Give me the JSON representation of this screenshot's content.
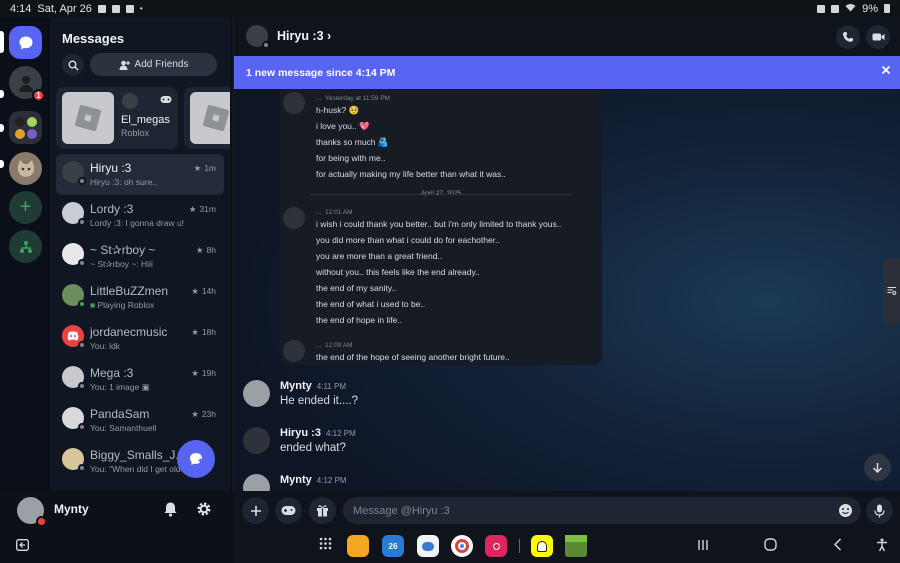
{
  "statusbar": {
    "time": "4:14",
    "date": "Sat, Apr 26",
    "battery": "9%"
  },
  "dm_panel": {
    "title": "Messages",
    "add_friends_label": "Add Friends",
    "rail_badge": "1",
    "activity": {
      "name": "El_megas",
      "game": "Roblox"
    },
    "dms": [
      {
        "name": "Hiryu :3",
        "sub": "Hiryu :3: oh sure..",
        "time": "1m",
        "active": true,
        "color": "#3b3f46"
      },
      {
        "name": "Lordy :3",
        "sub": "Lordy :3: I gonna draw u!",
        "time": "31m",
        "color": "#c9ccd1"
      },
      {
        "name": "~ St✰rboy ~",
        "sub": "~ St✰rboy ~: Hiii",
        "time": "8h",
        "color": "#e8e8e8"
      },
      {
        "name": "LittleBuZZmen",
        "sub": "Playing Roblox",
        "time": "14h",
        "color": "#6b8f5a"
      },
      {
        "name": "jordanecmusic",
        "sub": "You: ldk",
        "time": "18h",
        "color": "#ed4245"
      },
      {
        "name": "Mega :3",
        "sub": "You: 1 image",
        "time": "19h",
        "color": "#c7c9cc"
      },
      {
        "name": "PandaSam",
        "sub": "You: Samanthuell",
        "time": "23h",
        "color": "#d9d9d9"
      },
      {
        "name": "Biggy_Smalls_J...",
        "sub": "You: \"When did I get olde",
        "time": "",
        "color": "#d8c79a"
      }
    ]
  },
  "profile": {
    "name": "Mynty"
  },
  "chat": {
    "header_name": "Hiryu :3",
    "banner_text": "1 new message since 4:14 PM",
    "quoted": {
      "block1_meta": "Yesterday at 11:59 PM",
      "block1_lines": [
        "h-husk? 🥺",
        "i love you.. 💖",
        "thanks so much 🫂",
        "for being with me..",
        "for actually making my life better than what it was.."
      ],
      "date_divider": "April 27, 2025",
      "block2_meta": "12:01 AM",
      "block2_lines": [
        "i wish i could thank you better.. but i'm only limited to thank yous..",
        "you did more than what i could do for eachother..",
        "you are more than a great friend..",
        "without you.. this feels like the end already..",
        "the end of my sanity..",
        "the end of what i used to be..",
        "the end of hope in life.."
      ],
      "block3_meta": "12:09 AM",
      "block3_lines": [
        "the end of the hope of seeing another bright future.."
      ],
      "author_dots": "..."
    },
    "messages": [
      {
        "author": "Mynty",
        "time": "4:11 PM",
        "text": "He ended it....?"
      },
      {
        "author": "Hiryu :3",
        "time": "4:12 PM",
        "text": "ended what?"
      },
      {
        "author": "Mynty",
        "time": "4:12 PM",
        "text": ""
      }
    ],
    "composer_placeholder": "Message @Hiryu :3"
  },
  "taskbar": {
    "calendar_day": "26"
  },
  "colors": {
    "accent": "#5865f2",
    "danger": "#f23f43",
    "online": "#3ba55c"
  }
}
